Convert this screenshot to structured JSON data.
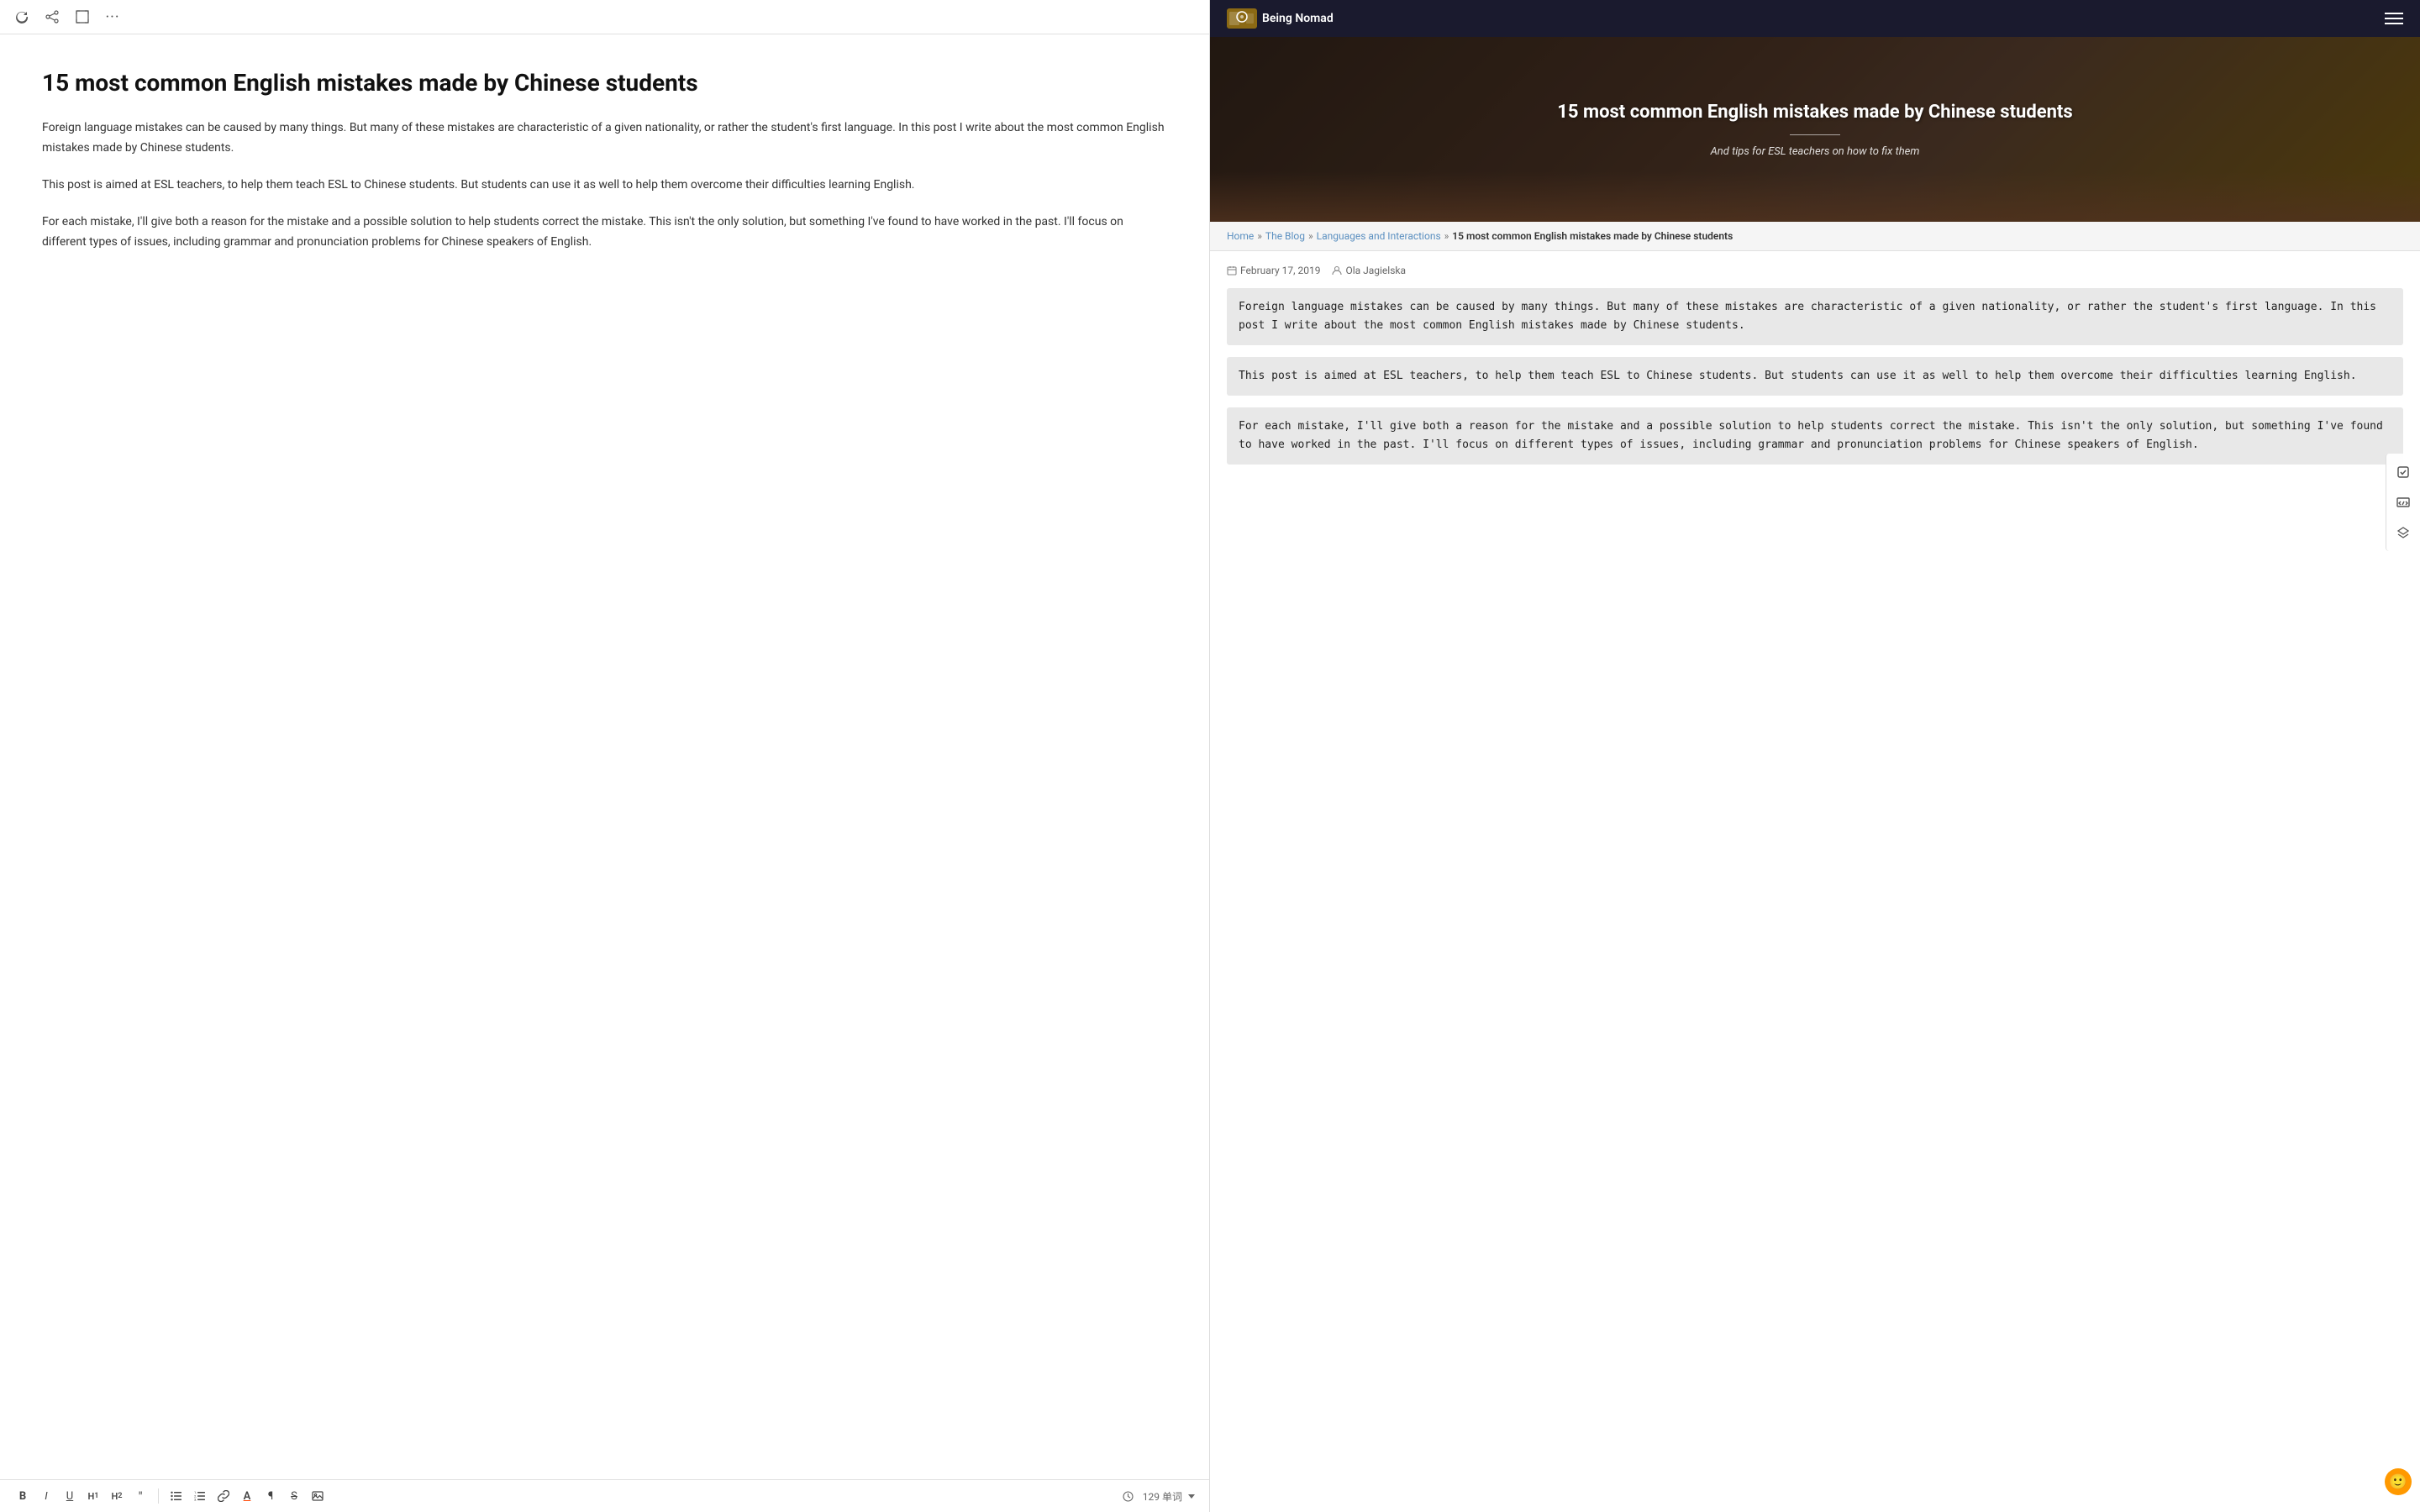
{
  "topToolbar": {
    "refresh_icon": "↻",
    "share_icon": "⤴",
    "expand_icon": "⛶",
    "more_icon": "···"
  },
  "editor": {
    "title": "15 most common English mistakes made by Chinese students",
    "paragraphs": [
      "Foreign language mistakes can be caused by many things. But many of these mistakes are characteristic of a given nationality, or rather the student's first language. In this post I write about the most common English mistakes made by Chinese students.",
      "This post is aimed at ESL teachers, to help them teach ESL to Chinese students. But students can use it as well to help them overcome their difficulties learning English.",
      "For each mistake, I'll give both a reason for the mistake and a possible solution to help students correct the mistake. This isn't the only solution, but something I've found to have worked in the past. I'll focus on different types of issues, including grammar and pronunciation problems for Chinese speakers of English."
    ],
    "wordCount": "129 单词",
    "toolbar": {
      "bold": "B",
      "italic": "I",
      "underline": "U",
      "h1": "H₁",
      "h2": "H₂",
      "quote": "\"",
      "list_ul": "≡",
      "list_ol": "≣",
      "link": "🔗",
      "underlineA": "A",
      "para": "¶",
      "strikethrough": "S",
      "image": "⊞"
    }
  },
  "blog": {
    "logoText": "Being Nomad",
    "hero": {
      "title": "15 most common English mistakes made by Chinese students",
      "subtitle": "And tips for ESL teachers on how to fix them"
    },
    "breadcrumb": {
      "home": "Home",
      "blog": "The Blog",
      "category": "Languages and Interactions",
      "current": "15 most common English mistakes made by Chinese students"
    },
    "meta": {
      "date": "February 17, 2019",
      "author": "Ola Jagielska"
    },
    "paragraphs": [
      "Foreign language mistakes can be caused by many things. But many of these mistakes are characteristic of a given nationality, or rather the student's first language. In this post I write about the most common English mistakes made by Chinese students.",
      "This post is aimed at ESL teachers, to help them teach ESL to Chinese students. But students can use it as well to help them overcome their difficulties learning English.",
      "For each mistake, I'll give both a reason for the mistake and a possible solution to help students correct the mistake. This isn't the only solution, but something I've found to have worked in the past. I'll focus on different types of issues, including grammar and pronunciation problems for Chinese speakers of English."
    ]
  }
}
